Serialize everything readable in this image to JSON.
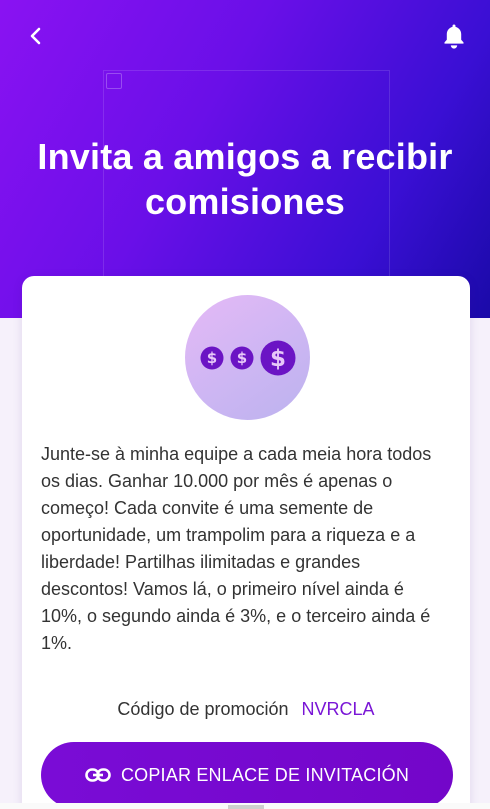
{
  "header": {
    "title": "Invita a amigos a recibir comisiones",
    "back_icon": "chevron-left-icon",
    "notification_icon": "bell-icon"
  },
  "card": {
    "illustration_icon": "dollar-coins-icon",
    "invite_message": "Junte-se à minha equipe a cada meia hora todos os dias. Ganhar 10.000 por mês é apenas o começo! Cada convite é uma semente de oportunidade, um trampolim para a riqueza e a liberdade! Partilhas ilimitadas e grandes descontos! Vamos lá, o primeiro nível ainda é 10%, o segundo ainda é 3%, e o terceiro ainda é 1%.",
    "promo_label": "Código de promoción",
    "promo_code": "NVRCLA",
    "copy_button_label": "COPIAR ENLACE DE INVITACIÓN",
    "copy_button_icon": "link-icon"
  },
  "colors": {
    "hero_gradient_start": "#8a12f2",
    "hero_gradient_end": "#1a0aa8",
    "accent": "#7a16d6",
    "button": "#7a0cd6"
  }
}
